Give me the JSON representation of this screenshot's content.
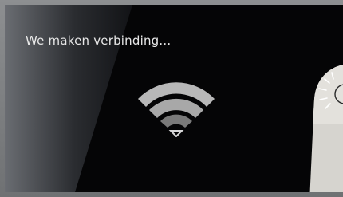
{
  "screen": {
    "status_text": "We maken verbinding...",
    "icon": "wifi-icon",
    "colors": {
      "background": "#050506",
      "text": "#e8e8e8",
      "wifi_outer": "#b8b8b8",
      "wifi_inner": "#7a7a7a"
    }
  },
  "remote": {
    "icon": "remote-control-icon"
  }
}
